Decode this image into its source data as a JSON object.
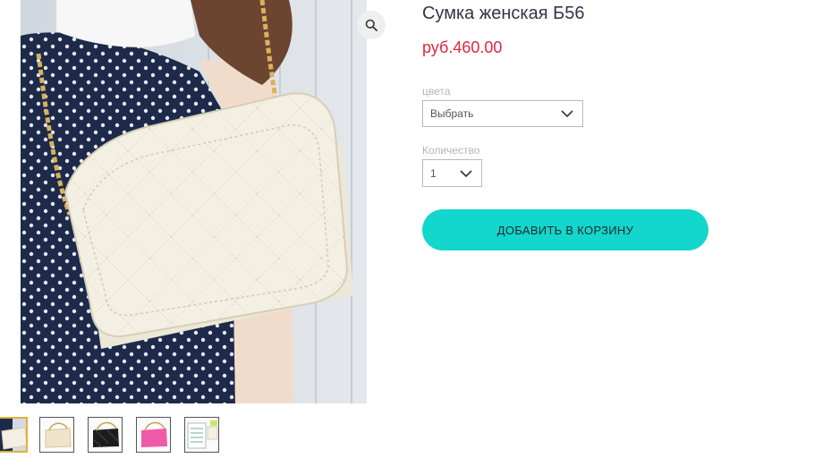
{
  "product": {
    "title": "Сумка женская Б56",
    "price": "руб.460.00"
  },
  "options": {
    "color": {
      "label": "цвета",
      "selected": "Выбрать"
    },
    "quantity": {
      "label": "Количество",
      "selected": "1"
    }
  },
  "actions": {
    "add_to_cart": "ДОБАВИТЬ В КОРЗИНУ"
  },
  "gallery": {
    "main_image": "white-quilted-crossbody-bag-photo",
    "zoom_icon": "magnifier-icon",
    "thumbnails": [
      {
        "image": "white-bag-thumbnail",
        "selected": true
      },
      {
        "image": "beige-bag-thumbnail",
        "selected": false
      },
      {
        "image": "black-bag-thumbnail",
        "selected": false
      },
      {
        "image": "pink-bag-thumbnail",
        "selected": false
      },
      {
        "image": "size-chart-thumbnail",
        "selected": false
      }
    ]
  },
  "colors": {
    "accent": "#13d6cc",
    "price": "#e0263c",
    "title": "#3a3046",
    "thumbnail_selected_border": "#e0b13a"
  }
}
